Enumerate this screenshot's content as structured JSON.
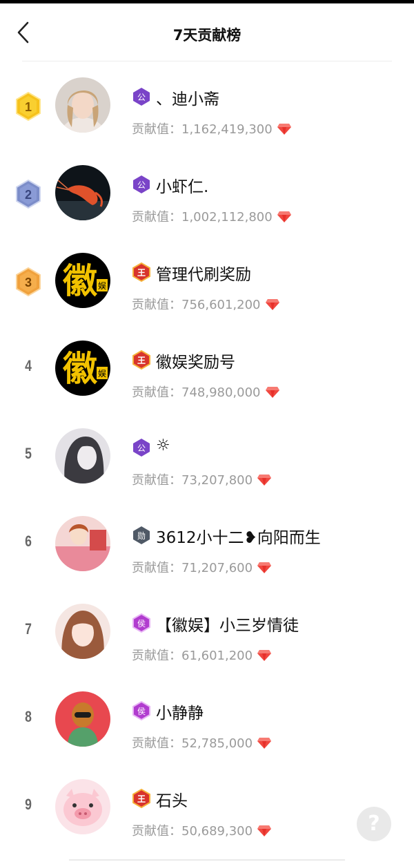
{
  "header": {
    "title": "7天贡献榜"
  },
  "contribution_label": "贡献值：",
  "level_badges": {
    "gong": "公",
    "wang": "王",
    "xun": "勋",
    "hou": "侯"
  },
  "ranking": [
    {
      "rank": "1",
      "name": "、迪小斋",
      "value": "1,162,419,300",
      "badge": "gong"
    },
    {
      "rank": "2",
      "name": "小虾仁.",
      "value": "1,002,112,800",
      "badge": "gong"
    },
    {
      "rank": "3",
      "name": "管理代刷奖励",
      "value": "756,601,200",
      "badge": "wang"
    },
    {
      "rank": "4",
      "name": "徽娱奖励号",
      "value": "748,980,000",
      "badge": "wang"
    },
    {
      "rank": "5",
      "name": "☼",
      "value": "73,207,800",
      "badge": "gong"
    },
    {
      "rank": "6",
      "name": "3612小十二❥向阳而生",
      "value": "71,207,600",
      "badge": "xun"
    },
    {
      "rank": "7",
      "name": "【徽娱】小三岁情徒",
      "value": "61,601,200",
      "badge": "hou"
    },
    {
      "rank": "8",
      "name": "小静静",
      "value": "52,785,000",
      "badge": "hou"
    },
    {
      "rank": "9",
      "name": "石头",
      "value": "50,689,300",
      "badge": "wang"
    }
  ],
  "avatar_text": {
    "hui": "徽",
    "yu": "娱"
  },
  "help": {
    "label": "?"
  },
  "colors": {
    "gold": "#f6c21c",
    "silver": "#7c8dc9",
    "bronze": "#f0a13c",
    "gong_badge": "#7a44c8",
    "wang_badge": "#d8342c",
    "xun_badge": "#4f5966",
    "hou_badge": "#b13ccf",
    "gem": "#f0473f"
  }
}
